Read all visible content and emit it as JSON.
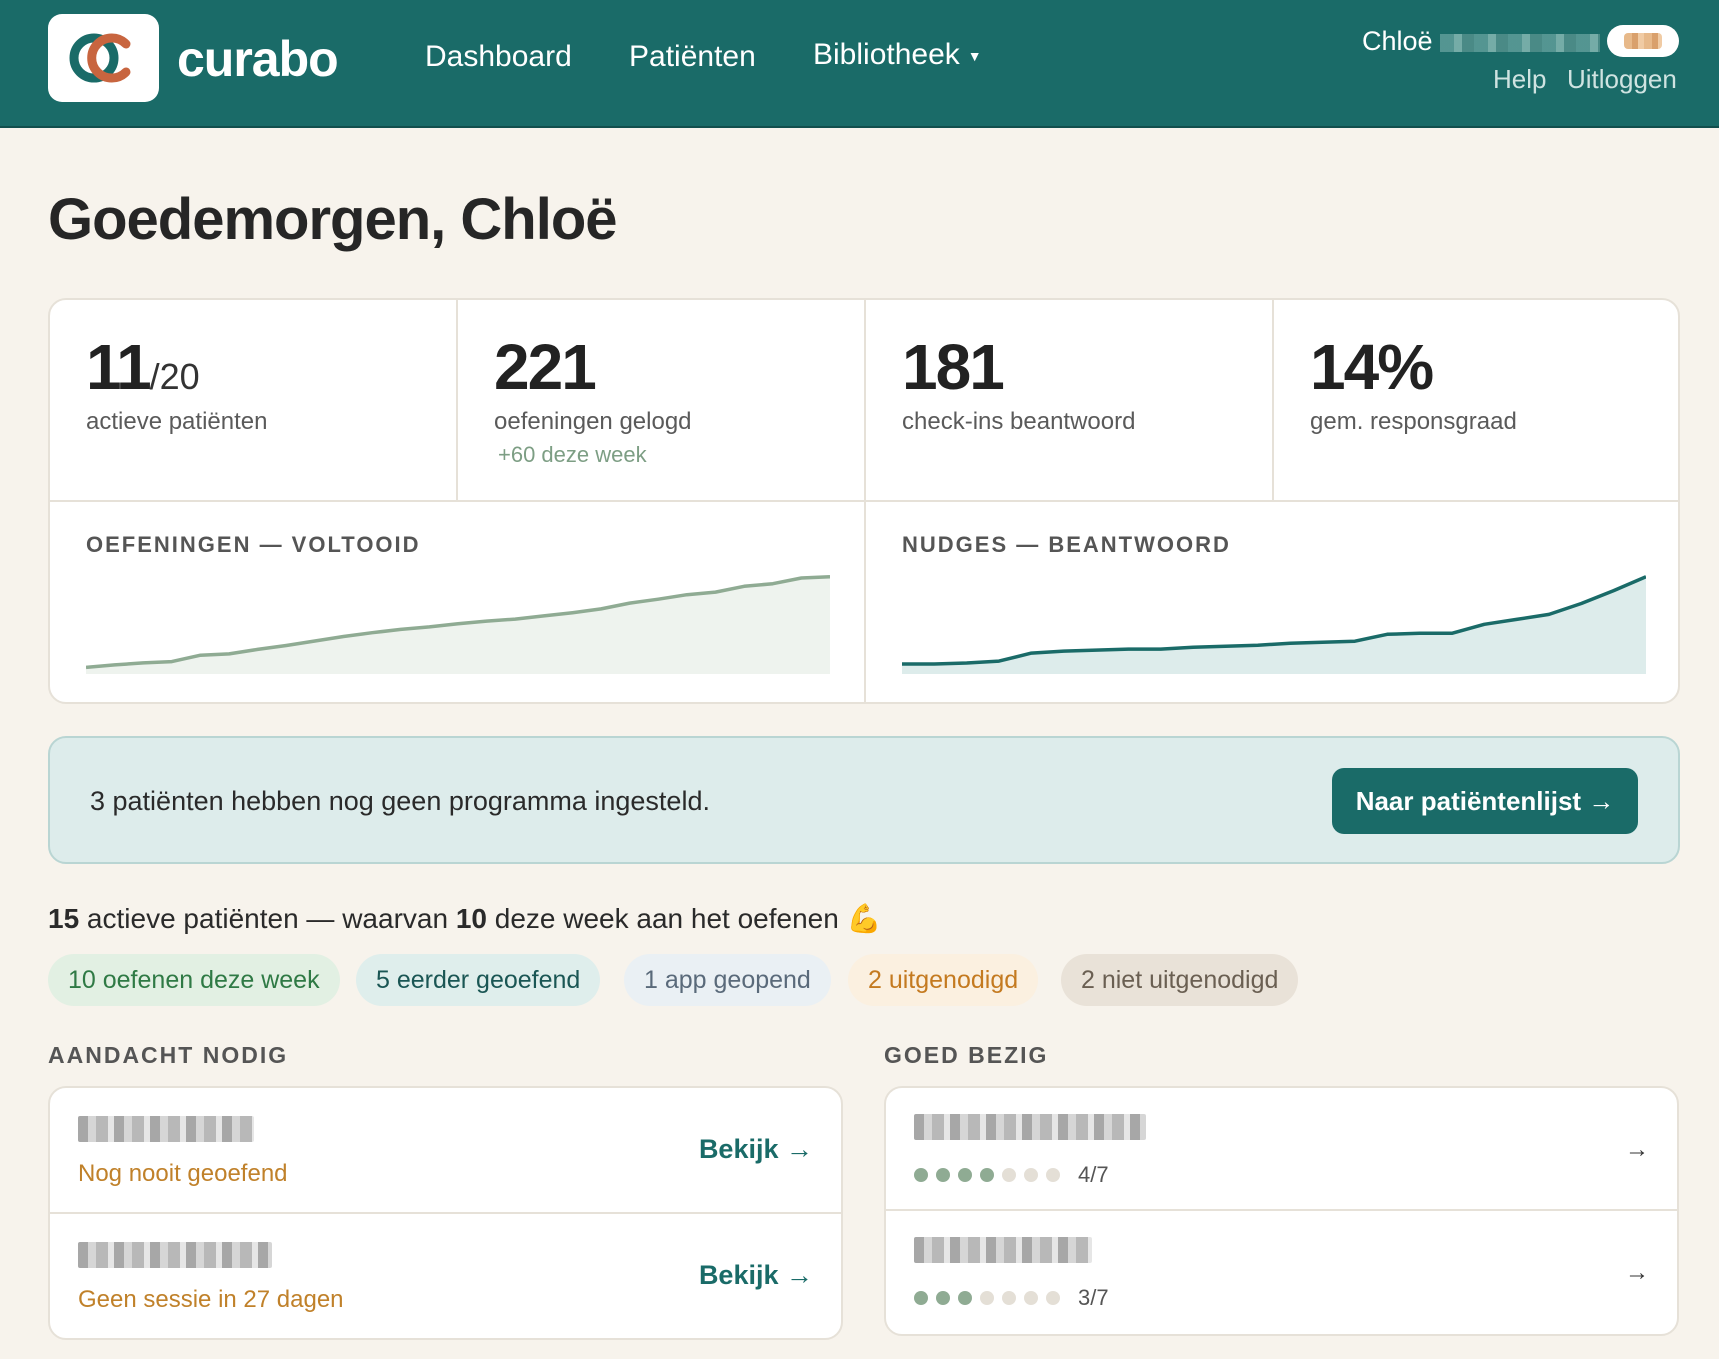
{
  "brand": {
    "name": "curabo"
  },
  "nav": {
    "items": [
      {
        "label": "Dashboard"
      },
      {
        "label": "Patiënten"
      },
      {
        "label": "Bibliotheek"
      }
    ]
  },
  "user": {
    "first_name": "Chloë",
    "help_label": "Help",
    "logout_label": "Uitloggen"
  },
  "greeting": "Goedemorgen, Chloë",
  "stats": [
    {
      "value": "11",
      "denominator": "/20",
      "label": "actieve patiënten"
    },
    {
      "value": "221",
      "label": "oefeningen gelogd",
      "delta": "+60 deze week"
    },
    {
      "value": "181",
      "label": "check-ins beantwoord"
    },
    {
      "value": "14%",
      "label": "gem. responsgraad"
    }
  ],
  "charts": {
    "left_title": "OEFENINGEN — VOLTOOID",
    "right_title": "NUDGES — BEANTWOORD"
  },
  "chart_data": [
    {
      "type": "area",
      "title": "OEFENINGEN — VOLTOOID",
      "color": "#8fab93",
      "fill": "#eef3ee",
      "values": [
        4,
        8,
        11,
        13,
        23,
        25,
        32,
        38,
        45,
        52,
        58,
        63,
        67,
        72,
        76,
        79,
        84,
        89,
        95,
        104,
        110,
        117,
        121,
        130,
        134,
        143,
        145
      ]
    },
    {
      "type": "area",
      "title": "NUDGES — BEANTWOORD",
      "color": "#1a6b68",
      "fill": "#ddeceb",
      "values": [
        6,
        6,
        7,
        9,
        17,
        19,
        20,
        21,
        21,
        23,
        24,
        25,
        27,
        28,
        29,
        36,
        37,
        37,
        46,
        51,
        56,
        67,
        80,
        94
      ]
    }
  ],
  "banner": {
    "text": "3 patiënten hebben nog geen programma ingesteld.",
    "button": "Naar patiëntenlijst →"
  },
  "summary": {
    "count_active": "15",
    "text_1": " actieve patiënten — waarvan ",
    "count_week": "10",
    "text_2": " deze week aan het oefenen 💪"
  },
  "filters": [
    {
      "label": "10 oefenen deze week"
    },
    {
      "label": "5 eerder geoefend"
    },
    {
      "label": "1 app geopend"
    },
    {
      "label": "2 uitgenodigd"
    },
    {
      "label": "2 niet uitgenodigd"
    }
  ],
  "attention": {
    "title": "AANDACHT NODIG",
    "rows": [
      {
        "status": "Nog nooit geoefend",
        "action": "Bekijk →"
      },
      {
        "status": "Geen sessie in 27 dagen",
        "action": "Bekijk →"
      }
    ]
  },
  "doing_well": {
    "title": "GOED BEZIG",
    "rows": [
      {
        "done": 4,
        "total": 7,
        "progress": "4/7",
        "action": "→"
      },
      {
        "done": 3,
        "total": 7,
        "progress": "3/7",
        "action": "→"
      }
    ]
  }
}
